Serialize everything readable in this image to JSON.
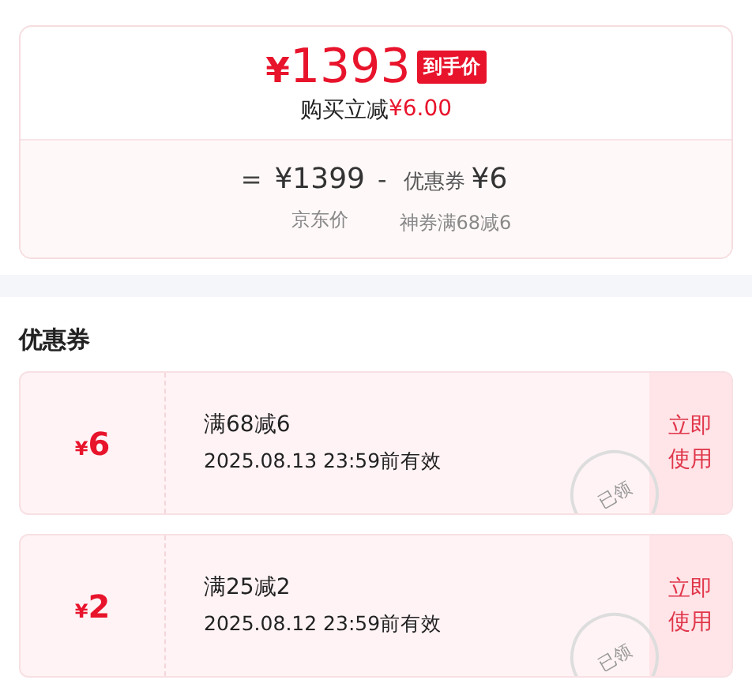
{
  "price_card": {
    "final_price": {
      "currency": "¥",
      "amount": "1393",
      "badge": "到手价"
    },
    "saving": {
      "label": "购买立减",
      "amount": "¥6.00"
    },
    "breakdown": [
      {
        "kind": "operator",
        "text": "="
      },
      {
        "kind": "term",
        "value": "¥1399",
        "caption": "京东价"
      },
      {
        "kind": "operator",
        "text": "-"
      },
      {
        "kind": "term",
        "prefix": "优惠券",
        "value": "¥6",
        "caption": "神券满68减6"
      }
    ]
  },
  "coupons_section": {
    "title": "优惠券",
    "coupons": [
      {
        "currency": "¥",
        "amount": "6",
        "condition": "满68减6",
        "validity": "2025.08.13 23:59前有效",
        "stamp": "已领",
        "action": "立即使用"
      },
      {
        "currency": "¥",
        "amount": "2",
        "condition": "满25减2",
        "validity": "2025.08.12 23:59前有效",
        "stamp": "已领",
        "action": "立即使用"
      }
    ]
  }
}
